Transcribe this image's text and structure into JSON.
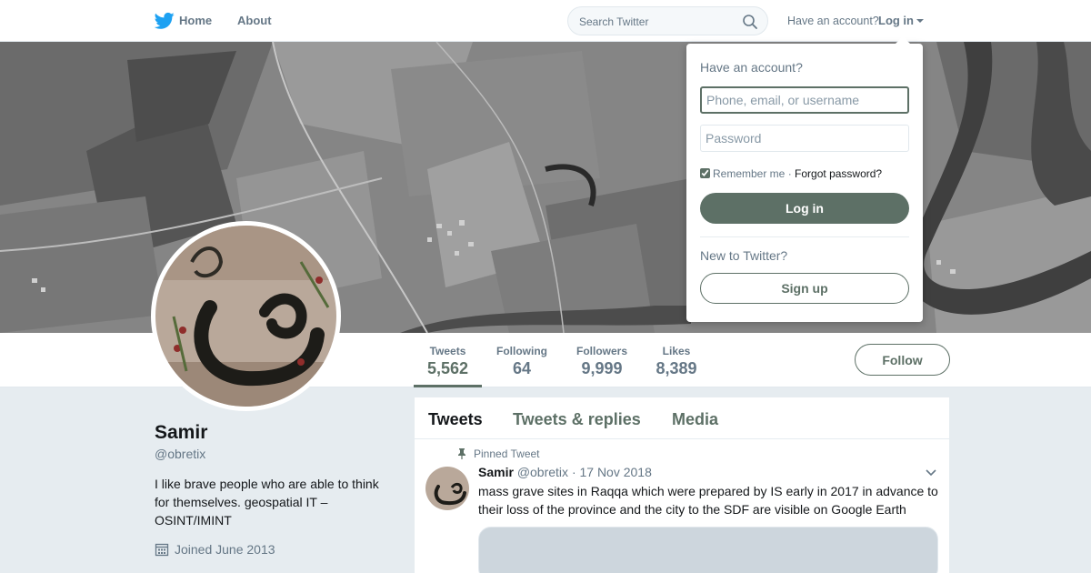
{
  "nav": {
    "logo_icon": "twitter-bird-icon",
    "home_label": "Home",
    "about_label": "About",
    "search_placeholder": "Search Twitter",
    "search_icon": "search-icon",
    "have_account": "Have an account?",
    "login_label": "Log in"
  },
  "profile": {
    "name": "Samir",
    "handle": "@obretix",
    "bio": "I like brave people who are able to think for themselves. geospatial IT – OSINT/IMINT",
    "joined": "Joined June 2013",
    "follow_label": "Follow"
  },
  "stats": [
    {
      "label": "Tweets",
      "value": "5,562"
    },
    {
      "label": "Following",
      "value": "64"
    },
    {
      "label": "Followers",
      "value": "9,999"
    },
    {
      "label": "Likes",
      "value": "8,389"
    }
  ],
  "timeline": {
    "tabs": [
      "Tweets",
      "Tweets & replies",
      "Media"
    ],
    "pinned_label": "Pinned Tweet",
    "tweet": {
      "name": "Samir",
      "handle": "@obretix",
      "date": "· 17 Nov 2018",
      "text": "mass grave sites in Raqqa which were prepared by IS early in 2017 in advance to their loss of the province and the city to the SDF are visible on Google Earth"
    }
  },
  "login_dropdown": {
    "title": "Have an account?",
    "username_placeholder": "Phone, email, or username",
    "password_placeholder": "Password",
    "remember_label": "Remember me",
    "separator": "·",
    "forgot_label": "Forgot password?",
    "login_button": "Log in",
    "new_label": "New to Twitter?",
    "signup_button": "Sign up"
  },
  "colors": {
    "accent": "#5d7066",
    "twitter_blue": "#1da1f2",
    "muted_text": "#657786"
  }
}
